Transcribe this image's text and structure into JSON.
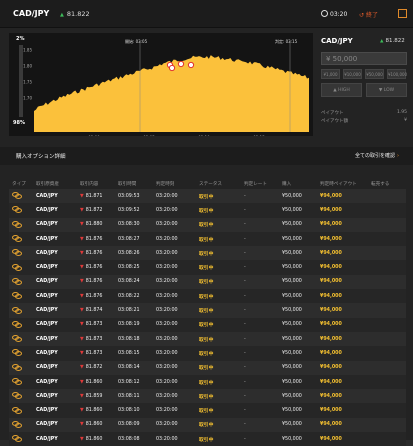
{
  "header": {
    "pair": "CAD/JPY",
    "rate": "81.822",
    "timer": "03:20",
    "end_label": "終了"
  },
  "chart": {
    "pct_top": "2%",
    "pct_bottom": "98%",
    "y_ticks": [
      "81.85",
      "81.80",
      "81.75",
      "81.70"
    ],
    "x_ticks": [
      "03:00",
      "03:05",
      "03:10",
      "03:15"
    ],
    "start_label": "開始: 03:05",
    "expiry_label": "判定: 03:15",
    "area_color": "#fbc13b"
  },
  "side_panel": {
    "pair": "CAD/JPY",
    "rate": "81.822",
    "amount_placeholder": "¥ 50,000",
    "quick_amounts": [
      "¥1,000",
      "¥10,000",
      "¥50,000",
      "¥100,000"
    ],
    "high_label": "HIGH",
    "low_label": "LOW",
    "payout_label": "ペイアウト",
    "payout_value": "1.95",
    "payout_amount_label": "ペイアウト額",
    "payout_amount_value": "¥"
  },
  "orders": {
    "title": "購入オプション詳細",
    "view_all": "全ての取引を確認",
    "columns": [
      "タイプ",
      "取引原資産",
      "取引内容",
      "取引時間",
      "判定時刻",
      "ステータス",
      "判定レート",
      "購入",
      "判定時ペイアウト",
      "転売する"
    ],
    "rows": [
      {
        "pair": "CAD/JPY",
        "rate": "81.871",
        "time": "03:09:53",
        "expiry": "03:20:00",
        "status": "取引中",
        "judge": "-",
        "amount": "¥50,000",
        "payout": "¥94,000"
      },
      {
        "pair": "CAD/JPY",
        "rate": "81.872",
        "time": "03:09:52",
        "expiry": "03:20:00",
        "status": "取引中",
        "judge": "-",
        "amount": "¥50,000",
        "payout": "¥94,000"
      },
      {
        "pair": "CAD/JPY",
        "rate": "81.880",
        "time": "03:08:30",
        "expiry": "03:20:00",
        "status": "取引中",
        "judge": "-",
        "amount": "¥50,000",
        "payout": "¥94,000"
      },
      {
        "pair": "CAD/JPY",
        "rate": "81.876",
        "time": "03:08:27",
        "expiry": "03:20:00",
        "status": "取引中",
        "judge": "-",
        "amount": "¥50,000",
        "payout": "¥94,000"
      },
      {
        "pair": "CAD/JPY",
        "rate": "81.876",
        "time": "03:08:26",
        "expiry": "03:20:00",
        "status": "取引中",
        "judge": "-",
        "amount": "¥50,000",
        "payout": "¥94,000"
      },
      {
        "pair": "CAD/JPY",
        "rate": "81.876",
        "time": "03:08:25",
        "expiry": "03:20:00",
        "status": "取引中",
        "judge": "-",
        "amount": "¥50,000",
        "payout": "¥94,000"
      },
      {
        "pair": "CAD/JPY",
        "rate": "81.876",
        "time": "03:08:24",
        "expiry": "03:20:00",
        "status": "取引中",
        "judge": "-",
        "amount": "¥50,000",
        "payout": "¥94,000"
      },
      {
        "pair": "CAD/JPY",
        "rate": "81.876",
        "time": "03:08:22",
        "expiry": "03:20:00",
        "status": "取引中",
        "judge": "-",
        "amount": "¥50,000",
        "payout": "¥94,000"
      },
      {
        "pair": "CAD/JPY",
        "rate": "81.874",
        "time": "03:08:21",
        "expiry": "03:20:00",
        "status": "取引中",
        "judge": "-",
        "amount": "¥50,000",
        "payout": "¥94,000"
      },
      {
        "pair": "CAD/JPY",
        "rate": "81.873",
        "time": "03:08:19",
        "expiry": "03:20:00",
        "status": "取引中",
        "judge": "-",
        "amount": "¥50,000",
        "payout": "¥94,000"
      },
      {
        "pair": "CAD/JPY",
        "rate": "81.873",
        "time": "03:08:18",
        "expiry": "03:20:00",
        "status": "取引中",
        "judge": "-",
        "amount": "¥50,000",
        "payout": "¥94,000"
      },
      {
        "pair": "CAD/JPY",
        "rate": "81.873",
        "time": "03:08:15",
        "expiry": "03:20:00",
        "status": "取引中",
        "judge": "-",
        "amount": "¥50,000",
        "payout": "¥94,000"
      },
      {
        "pair": "CAD/JPY",
        "rate": "81.872",
        "time": "03:08:14",
        "expiry": "03:20:00",
        "status": "取引中",
        "judge": "-",
        "amount": "¥50,000",
        "payout": "¥94,000"
      },
      {
        "pair": "CAD/JPY",
        "rate": "81.860",
        "time": "03:08:12",
        "expiry": "03:20:00",
        "status": "取引中",
        "judge": "-",
        "amount": "¥50,000",
        "payout": "¥94,000"
      },
      {
        "pair": "CAD/JPY",
        "rate": "81.859",
        "time": "03:08:11",
        "expiry": "03:20:00",
        "status": "取引中",
        "judge": "-",
        "amount": "¥50,000",
        "payout": "¥94,000"
      },
      {
        "pair": "CAD/JPY",
        "rate": "81.860",
        "time": "03:08:10",
        "expiry": "03:20:00",
        "status": "取引中",
        "judge": "-",
        "amount": "¥50,000",
        "payout": "¥94,000"
      },
      {
        "pair": "CAD/JPY",
        "rate": "81.860",
        "time": "03:08:09",
        "expiry": "03:20:00",
        "status": "取引中",
        "judge": "-",
        "amount": "¥50,000",
        "payout": "¥94,000"
      },
      {
        "pair": "CAD/JPY",
        "rate": "81.860",
        "time": "03:08:08",
        "expiry": "03:20:00",
        "status": "取引中",
        "judge": "-",
        "amount": "¥50,000",
        "payout": "¥94,000"
      }
    ]
  }
}
